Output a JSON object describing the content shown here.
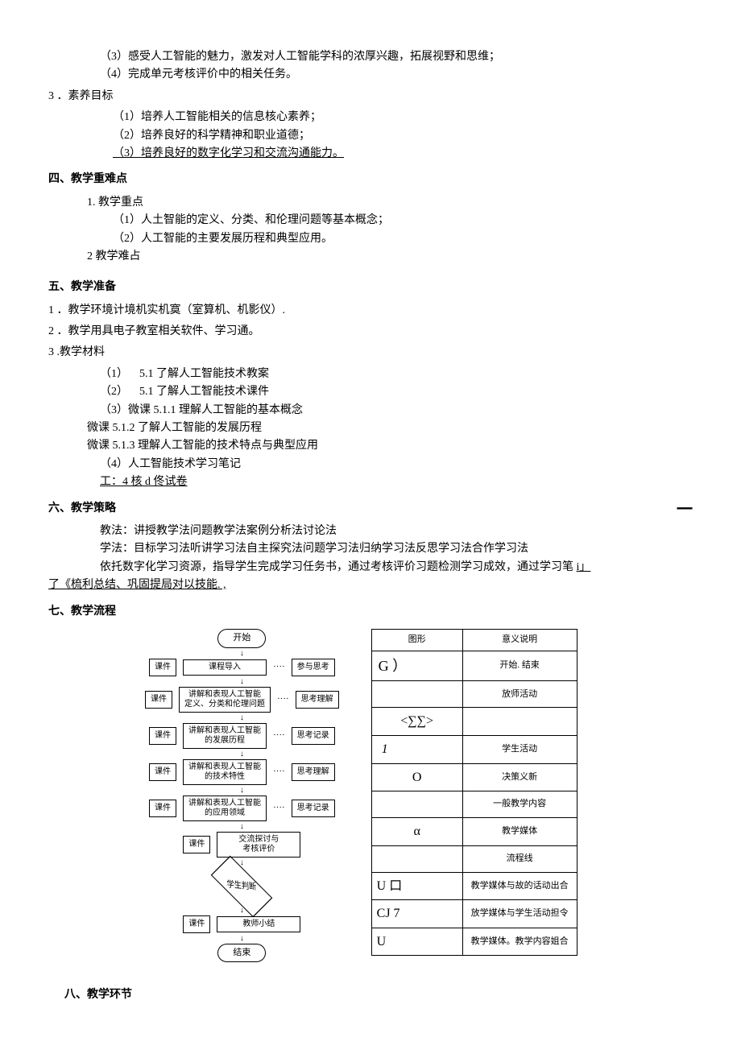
{
  "intro": {
    "item3_3": "（3）感受人工智能的魅力，激发对人工智能学科的浓厚兴趣，拓展视野和思维；",
    "item3_4": "（4）完成单元考核评价中的相关任务。"
  },
  "goal3": {
    "num": "3 ．素养目标",
    "i1": "（1）培养人工智能相关的信息核心素养；",
    "i2": "（2）培养良好的科学精神和职业道德；",
    "i3": "（3）培养良好的数字化学习和交流沟通能力。"
  },
  "sec4": {
    "title": "四、教学重难点",
    "p1": "1. 教学重点",
    "p1_1": "（1）人土智能的定义、分类、和伦理问题等基本概念；",
    "p1_2": "（2）人工智能的主要发展历程和典型应用。",
    "p2": "2 教学难占"
  },
  "sec5": {
    "title": "五、教学准备",
    "i1": "1 ．教学环境计境机实机寞（室算机、机影仪）.",
    "i2": "2 ．教学用具电子教室相关软件、学习通。",
    "i3": "3   .教学材料",
    "m1a": "（1）",
    "m1b": "5.1 了解人工智能技术教案",
    "m2a": "（2）",
    "m2b": "5.1 了解人工智能技术课件",
    "m3": "（3）微课 5.1.1 理解人工智能的基本概念",
    "mc2": "微课 5.1.2 了解人工智能的发展历程",
    "mc3": "微课 5.1.3 理解人工智能的技术特点与典型应用",
    "m4": "（4）人工智能技术学习笔记",
    "m5": "工：4 核 d 佟试卷"
  },
  "sec6": {
    "title": "六、教学策略",
    "dash": "一",
    "l1": "教法：讲授教学法问题教学法案例分析法讨论法",
    "l2": "学法：目标学习法听讲学习法自主探究法问题学习法归纳学习法反思学习法合作学习法",
    "l3a": "依托数字化学习资源，指导学生完成学习任务书，通过考核评价习题检测学习成效，通过学习笔 ",
    "l3b": "i」",
    "l4": "了《梳利总结、巩固提局对以技能. ,"
  },
  "sec7": {
    "title": "七、教学流程"
  },
  "flow": {
    "start": "开始",
    "kj": "课件",
    "n1": "课程导入",
    "r1": "参与思考",
    "n2": "讲解和表现人工智能\n定义、分类和伦理问题",
    "r2": "思考理解",
    "n3": "讲解和表现人工智能\n的发展历程",
    "r3": "思考记录",
    "n4": "讲解和表现人工智能\n的技术特性",
    "r4": "思考理解",
    "n5": "讲解和表现人工智能\n的应用领域",
    "r5": "思考记录",
    "n6": "交流探讨与\n考核评价",
    "judge": "学生判断",
    "n7": "教师小结",
    "end": "结束"
  },
  "legend": {
    "h1": "图形",
    "h2": "意义说明",
    "r1s": "G   ）",
    "r1t": "开始. 结束",
    "r2s": "",
    "r2t": "放师活动",
    "r3s": "<∑∑>",
    "r3t": "",
    "r4s": "1",
    "r4t": "学生活动",
    "r5s": "O",
    "r5t": "决策义新",
    "r6s": "",
    "r6t": "一般教学内容",
    "r7s": "α",
    "r7t": "教学媒体",
    "r8s": "",
    "r8t": "流程线",
    "r9s": "U  口",
    "r9t": "教学媒体与故的话动出合",
    "r10s": "CJ   7",
    "r10t": "放学媒体与学生活动担令",
    "r11s": "U",
    "r11t": "教学媒体。教学内容姐合"
  },
  "sec8": {
    "title": "八、教学环节"
  }
}
